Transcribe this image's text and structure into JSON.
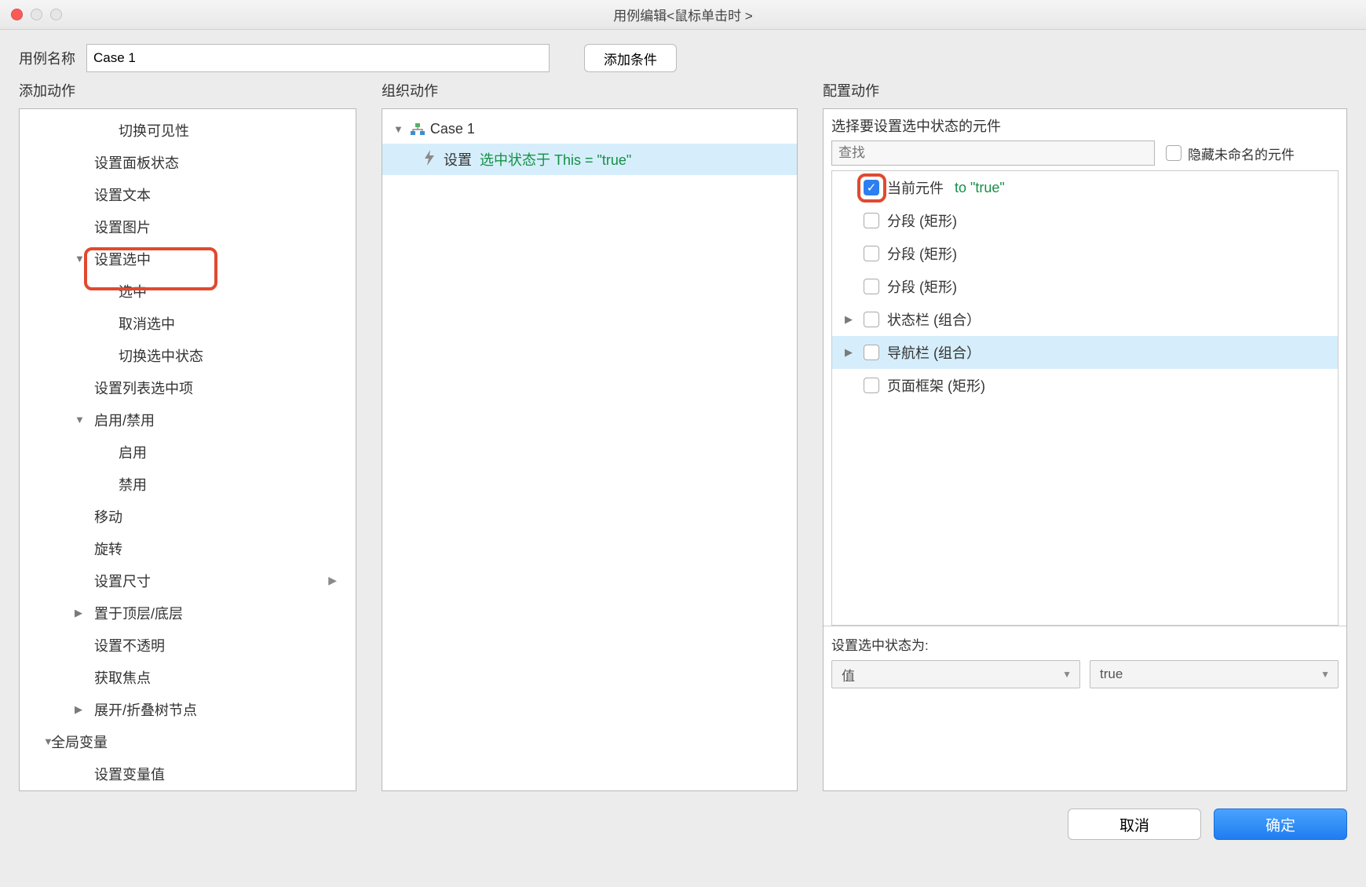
{
  "window": {
    "title": "用例编辑<鼠标单击时 >"
  },
  "top": {
    "case_name_label": "用例名称",
    "case_name_value": "Case 1",
    "add_condition": "添加条件"
  },
  "sections": {
    "add_action": "添加动作",
    "organize_action": "组织动作",
    "configure_action": "配置动作"
  },
  "actions": {
    "items": [
      {
        "label": "切换可见性",
        "indent": 2
      },
      {
        "label": "设置面板状态",
        "indent": 1
      },
      {
        "label": "设置文本",
        "indent": 1
      },
      {
        "label": "设置图片",
        "indent": 1
      },
      {
        "label": "设置选中",
        "indent": 1,
        "expander": "down",
        "exp_at": 1
      },
      {
        "label": "选中",
        "indent": 2,
        "highlight": true
      },
      {
        "label": "取消选中",
        "indent": 2
      },
      {
        "label": "切换选中状态",
        "indent": 2
      },
      {
        "label": "设置列表选中项",
        "indent": 1
      },
      {
        "label": "启用/禁用",
        "indent": 1,
        "expander": "down",
        "exp_at": 1
      },
      {
        "label": "启用",
        "indent": 2
      },
      {
        "label": "禁用",
        "indent": 2
      },
      {
        "label": "移动",
        "indent": 1
      },
      {
        "label": "旋转",
        "indent": 1
      },
      {
        "label": "设置尺寸",
        "indent": 1,
        "submenu": true
      },
      {
        "label": "置于顶层/底层",
        "indent": 1,
        "expander": "right",
        "exp_at": 1
      },
      {
        "label": "设置不透明",
        "indent": 1
      },
      {
        "label": "获取焦点",
        "indent": 1
      },
      {
        "label": "展开/折叠树节点",
        "indent": 1,
        "expander": "right",
        "exp_at": 1
      },
      {
        "label": "全局变量",
        "indent": 0,
        "expander": "down",
        "exp_at": 0
      },
      {
        "label": "设置变量值",
        "indent": 1
      }
    ]
  },
  "case_tree": {
    "case_label": "Case 1",
    "action_prefix": "设置 ",
    "action_green": "选中状态于 This = \"true\""
  },
  "config": {
    "select_widget_label": "选择要设置选中状态的元件",
    "search_placeholder": "查找",
    "hide_unnamed_label": "隐藏未命名的元件",
    "widgets": [
      {
        "label": "当前元件",
        "checked": true,
        "suffix": "to \"true\"",
        "highlight": true
      },
      {
        "label": "分段 (矩形)"
      },
      {
        "label": "分段 (矩形)"
      },
      {
        "label": "分段 (矩形)"
      },
      {
        "label": "状态栏 (组合）",
        "tri": "right"
      },
      {
        "label": "导航栏 (组合）",
        "tri": "right",
        "selected": true
      },
      {
        "label": "页面框架 (矩形)"
      }
    ],
    "set_state_label": "设置选中状态为:",
    "select1": "值",
    "select2": "true"
  },
  "footer": {
    "cancel": "取消",
    "ok": "确定"
  }
}
